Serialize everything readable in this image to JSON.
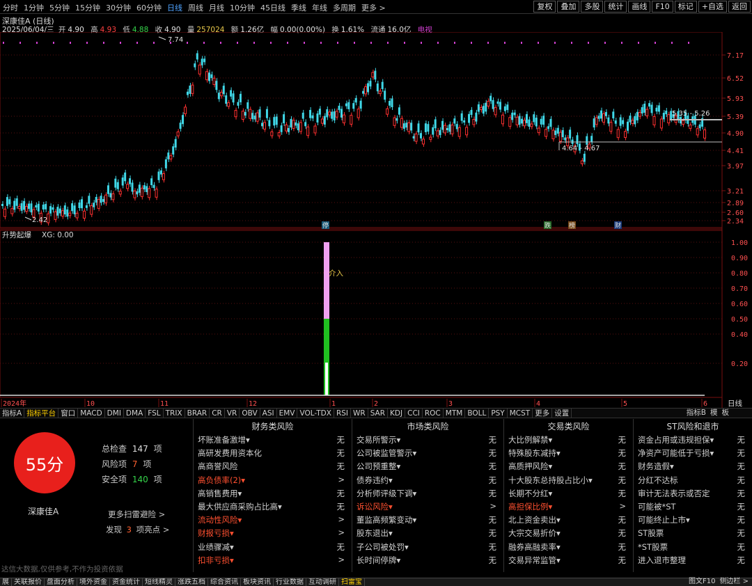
{
  "toolbar": {
    "periods": [
      "分时",
      "1分钟",
      "5分钟",
      "15分钟",
      "30分钟",
      "60分钟",
      "日线",
      "周线",
      "月线",
      "10分钟",
      "45日线",
      "季线",
      "年线",
      "多周期",
      "更多 >"
    ],
    "active_period_index": 6,
    "right_buttons": [
      "复权",
      "叠加",
      "多股",
      "统计",
      "画线",
      "F10",
      "标记",
      "+自选",
      "返回"
    ]
  },
  "stock": {
    "title": "深康佳A (日线)",
    "date": "2025/06/04/三",
    "open_label": "开",
    "open": "4.90",
    "high_label": "高",
    "high": "4.93",
    "low_label": "低",
    "low": "4.88",
    "close_label": "收",
    "close": "4.90",
    "volume_label": "量",
    "volume": "257024",
    "amount_label": "额",
    "amount": "1.26亿",
    "change_label": "幅",
    "change": "0.00(0.00%)",
    "turnover_label": "换",
    "turnover": "1.61%",
    "float_label": "流通",
    "float": "16.0亿",
    "sector": "电视"
  },
  "main_chart": {
    "price_axis": [
      "7.17",
      "6.52",
      "5.93",
      "5.39",
      "4.90",
      "4.41",
      "3.97",
      "3.21",
      "2.89",
      "2.60",
      "2.34"
    ],
    "annotations": {
      "peak": "7.74",
      "low": "2.42",
      "range_upper": "5.35 - 5.26",
      "range_lower": "4.64 - 4.67"
    },
    "event_markers": [
      "停",
      "跌",
      "榜",
      "财"
    ]
  },
  "sub_chart": {
    "title": "升势起爆",
    "xg_label": "XG: 0.00",
    "axis": [
      "1.00",
      "0.90",
      "0.80",
      "0.70",
      "0.60",
      "0.50",
      "0.40",
      "0.20"
    ],
    "signal_label": "介入"
  },
  "time_axis": [
    "2024年",
    "10",
    "11",
    "12",
    "1",
    "2",
    "3",
    "4",
    "5",
    "6"
  ],
  "time_axis_right": "日线",
  "indicator_tabs": [
    "指标A",
    "指标平台",
    "窗口",
    "MACD",
    "DMI",
    "DMA",
    "FSL",
    "TRIX",
    "BRAR",
    "CR",
    "VR",
    "OBV",
    "ASI",
    "EMV",
    "VOL-TDX",
    "RSI",
    "WR",
    "SAR",
    "KDJ",
    "CCI",
    "ROC",
    "MTM",
    "BOLL",
    "PSY",
    "MCST",
    "更多",
    "设置"
  ],
  "indicator_tabs_right": [
    "指标B",
    "模",
    "板"
  ],
  "risk": {
    "score": "55分",
    "stock_name": "深康佳A",
    "total_label": "总检查",
    "total": "147",
    "total_unit": "项",
    "risk_label": "风险项",
    "risk_count": "7",
    "risk_unit": "项",
    "safe_label": "安全项",
    "safe_count": "140",
    "safe_unit": "项",
    "more_scan": "更多扫雷避险 >",
    "found_prefix": "发现",
    "found_count": "3",
    "found_suffix": "项亮点 >",
    "disclaimer": "达信大数据,仅供参考,不作为投资依据",
    "columns": [
      {
        "header": "财务类风险",
        "rows": [
          {
            "name": "坏账准备激增▾",
            "value": "无",
            "warn": false
          },
          {
            "name": "高研发费用资本化",
            "value": "无",
            "warn": false
          },
          {
            "name": "高商誉风险",
            "value": "无",
            "warn": false
          },
          {
            "name": "高负债率(2)▾",
            "value": ">",
            "warn": true
          },
          {
            "name": "高销售费用▾",
            "value": "无",
            "warn": false
          },
          {
            "name": "最大供应商采购占比高▾",
            "value": "无",
            "warn": false
          },
          {
            "name": "流动性风险▾",
            "value": ">",
            "warn": true
          },
          {
            "name": "财报亏损▾",
            "value": ">",
            "warn": true
          },
          {
            "name": "业绩骤减▾",
            "value": "无",
            "warn": false
          },
          {
            "name": "扣非亏损▾",
            "value": ">",
            "warn": true
          }
        ]
      },
      {
        "header": "市场类风险",
        "rows": [
          {
            "name": "交易所警示▾",
            "value": "无",
            "warn": false
          },
          {
            "name": "公司被监管警示▾",
            "value": "无",
            "warn": false
          },
          {
            "name": "公司预重整▾",
            "value": "无",
            "warn": false
          },
          {
            "name": "债券违约▾",
            "value": "无",
            "warn": false
          },
          {
            "name": "分析师评级下调▾",
            "value": "无",
            "warn": false
          },
          {
            "name": "诉讼风险▾",
            "value": ">",
            "warn": true
          },
          {
            "name": "董监高频繁变动▾",
            "value": "无",
            "warn": false
          },
          {
            "name": "股东退出▾",
            "value": "无",
            "warn": false
          },
          {
            "name": "子公司被处罚▾",
            "value": "无",
            "warn": false
          },
          {
            "name": "长时间停牌▾",
            "value": "无",
            "warn": false
          }
        ]
      },
      {
        "header": "交易类风险",
        "rows": [
          {
            "name": "大比例解禁▾",
            "value": "无",
            "warn": false
          },
          {
            "name": "特殊股东减持▾",
            "value": "无",
            "warn": false
          },
          {
            "name": "高质押风险▾",
            "value": "无",
            "warn": false
          },
          {
            "name": "十大股东总持股占比小▾",
            "value": "无",
            "warn": false
          },
          {
            "name": "长期不分红▾",
            "value": "无",
            "warn": false
          },
          {
            "name": "高担保比例▾",
            "value": ">",
            "warn": true
          },
          {
            "name": "北上资金卖出▾",
            "value": "无",
            "warn": false
          },
          {
            "name": "大宗交易折价▾",
            "value": "无",
            "warn": false
          },
          {
            "name": "融券高融卖率▾",
            "value": "无",
            "warn": false
          },
          {
            "name": "交易异常监管▾",
            "value": "无",
            "warn": false
          }
        ]
      },
      {
        "header": "ST风险和退市",
        "rows": [
          {
            "name": "资金占用或违规担保▾",
            "value": "无",
            "warn": false
          },
          {
            "name": "净资产可能低于亏损▾",
            "value": "无",
            "warn": false
          },
          {
            "name": "财务造假▾",
            "value": "无",
            "warn": false
          },
          {
            "name": "分红不达标",
            "value": "无",
            "warn": false
          },
          {
            "name": "审计无法表示或否定",
            "value": "无",
            "warn": false
          },
          {
            "name": "可能被*ST",
            "value": "无",
            "warn": false
          },
          {
            "name": "可能终止上市▾",
            "value": "无",
            "warn": false
          },
          {
            "name": "ST股票",
            "value": "无",
            "warn": false
          },
          {
            "name": "*ST股票",
            "value": "无",
            "warn": false
          },
          {
            "name": "进入退市整理",
            "value": "无",
            "warn": false
          }
        ]
      }
    ]
  },
  "status_tabs": [
    "展",
    "关联报价",
    "盘面分析",
    "境外资金",
    "资金统计",
    "短线精灵",
    "涨跌五档",
    "综合资讯",
    "板块资讯",
    "行业数据",
    "互动调研",
    "扫雷宝"
  ],
  "status_active_index": 11,
  "status_right": [
    "图文F10",
    "侧边栏 >"
  ],
  "colors": {
    "up": "#ff3030",
    "down": "#40d8e8",
    "score_circle": "#e8201c",
    "signal_pink": "#f0a0f0",
    "signal_green": "#20c020"
  }
}
